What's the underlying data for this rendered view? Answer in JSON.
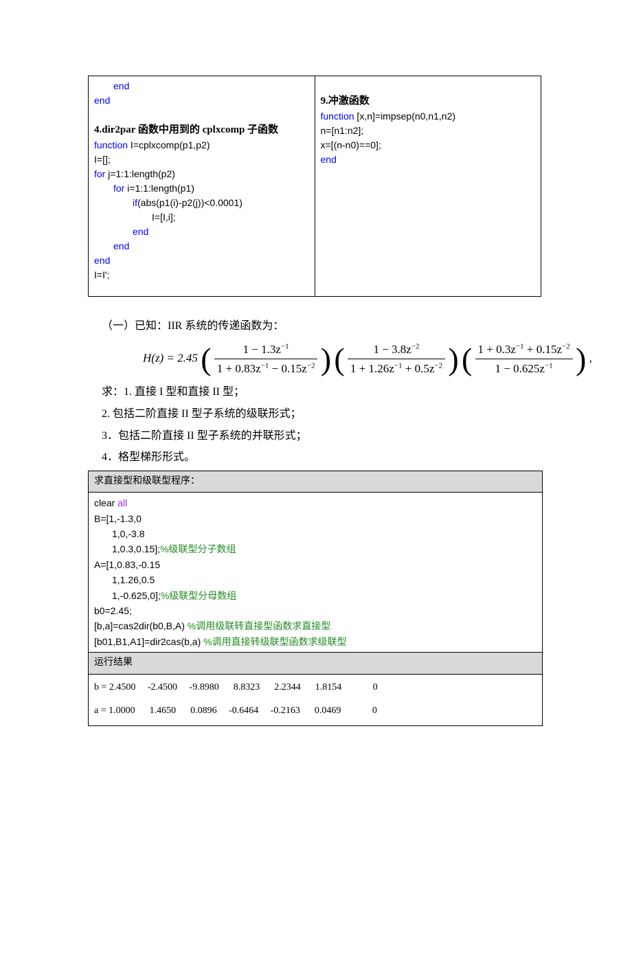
{
  "top": {
    "left": {
      "l1": "end",
      "l2": "end",
      "heading": "4.dir2par 函数中用到的 cplxcomp 子函数",
      "c1": "function",
      "c1b": " I=cplxcomp(p1,p2)",
      "c2": "I=[];",
      "c3a": "for",
      "c3b": " j=1:1:length(p2)",
      "c4a": "for",
      "c4b": " i=1:1:length(p1)",
      "c5a": "if",
      "c5b": "(abs(p1(i)-p2(j))<0.0001)",
      "c6": "I=[I,i];",
      "c7": "end",
      "c8": "end",
      "c9": "end",
      "c10": "I=I';"
    },
    "right": {
      "heading": "9.冲激函数",
      "r1a": "function",
      "r1b": " [x,n]=impsep(n0,n1,n2)",
      "r2": "n=[n1:n2];",
      "r3": "x=[(n-n0)==0];",
      "r4": "end"
    }
  },
  "body": {
    "p1": "（一）已知：IIR 系统的传递函数为：",
    "formula": {
      "lead": "H(z) = 2.45",
      "f1num": "1 − 1.3z",
      "f1numE": "−1",
      "f1den": "1 + 0.83z",
      "f1denE1": "−1",
      "f1denM": " − 0.15z",
      "f1denE2": "−2",
      "f2num": "1 − 3.8z",
      "f2numE": "−2",
      "f2den": "1 + 1.26z",
      "f2denE1": "−1",
      "f2denM": " + 0.5z",
      "f2denE2": "−2",
      "f3numA": "1 + 0.3z",
      "f3numE1": "−1",
      "f3numB": " + 0.15z",
      "f3numE2": "−2",
      "f3den": "1 − 0.625z",
      "f3denE": "−1",
      "tail": ","
    },
    "p2": "求：1.  直接 I 型和直接 II 型；",
    "p3": "2.  包括二阶直接 II 型子系统的级联形式；",
    "p4": "3．包括二阶直接 II 型子系统的并联形式；",
    "p5": "4．格型梯形形式。"
  },
  "box": {
    "hdr1": "求直接型和级联型程序：",
    "l1": "clear ",
    "l1k": "all",
    "l2": "B=[1,-1.3,0",
    "l3": "1,0,-3.8",
    "l4a": "1,0.3,0.15];",
    "l4b": "%级联型分子数组",
    "l5": "A=[1,0.83,-0.15",
    "l6": "1,1.26,0.5",
    "l7a": "1,-0.625,0];",
    "l7b": "%级联型分母数组",
    "l8": "b0=2.45;",
    "l9a": "[b,a]=cas2dir(b0,B,A) ",
    "l9b": "%调用级联转直接型函数求直接型",
    "l10a": "[b01,B1,A1]=dir2cas(b,a) ",
    "l10b": "%调用直接转级联型函数求级联型",
    "hdr2": "运行结果",
    "rb": "b = 2.4500     -2.4500     -9.8980      8.8323      2.2344      1.8154             0",
    "ra": "a = 1.0000      1.4650      0.0896     -0.6464     -0.2163      0.0469             0"
  }
}
